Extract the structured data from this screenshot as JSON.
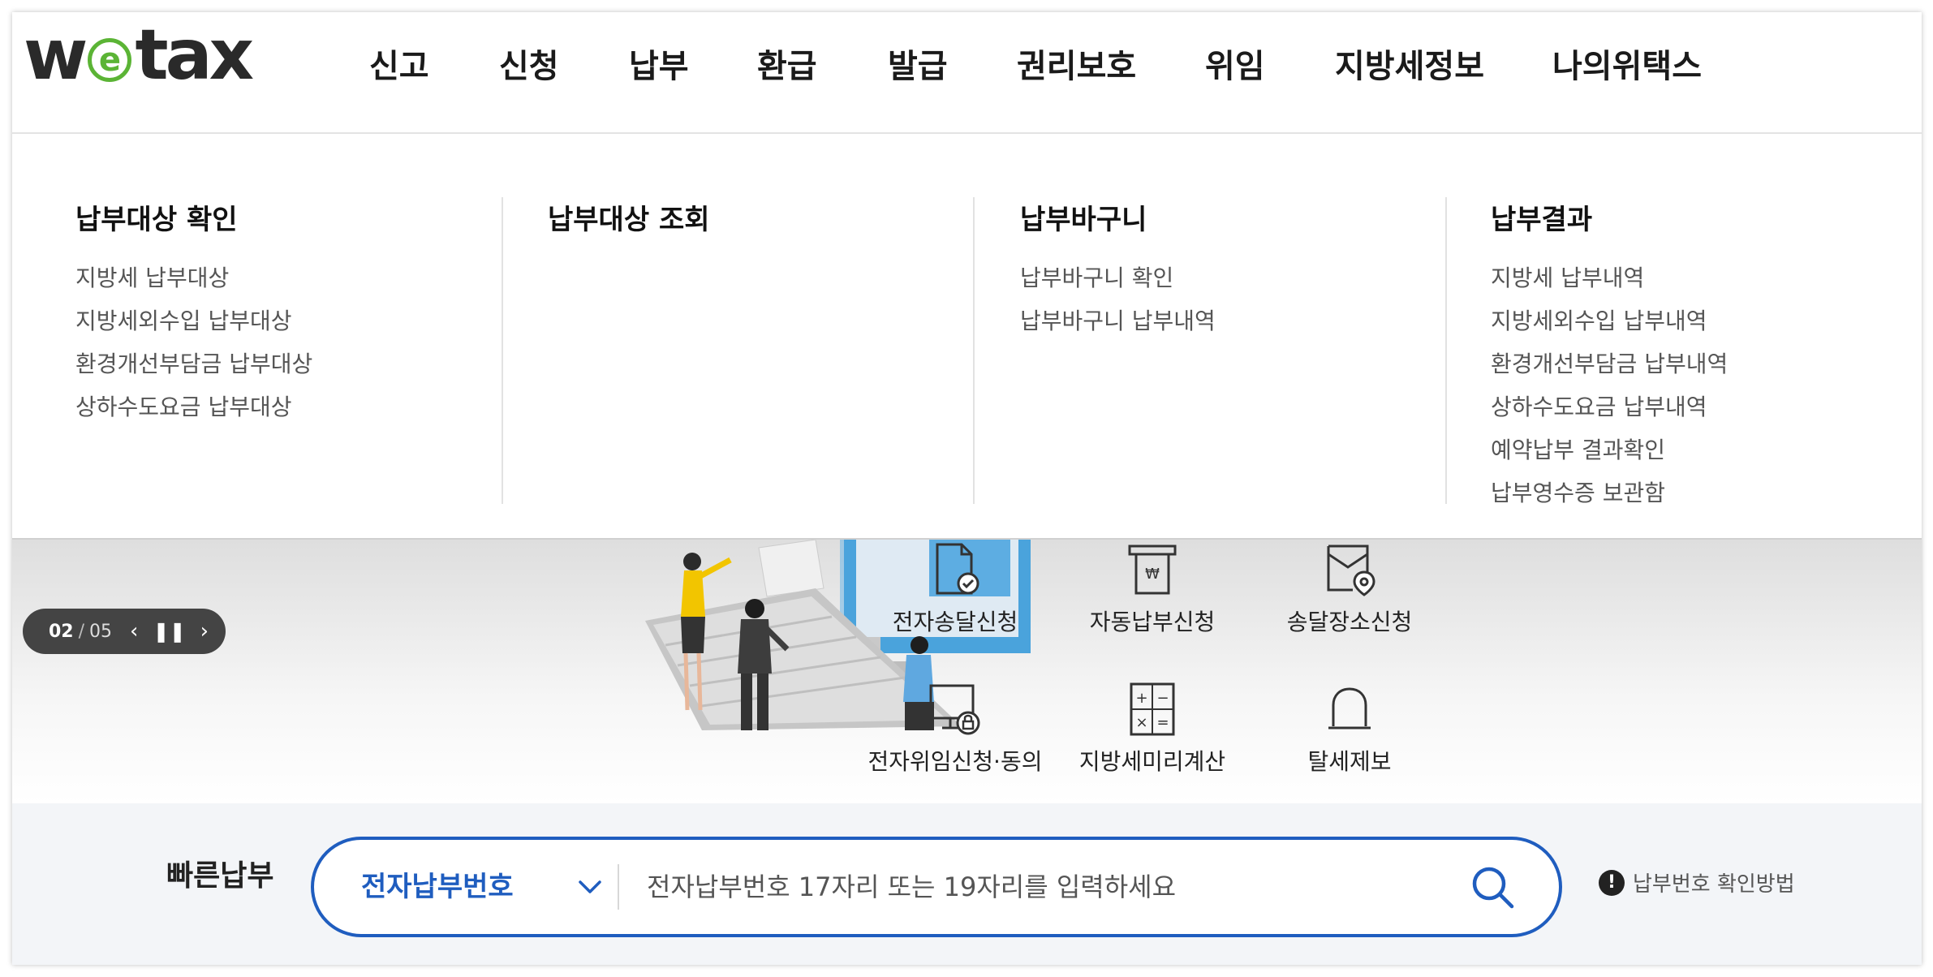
{
  "logo": {
    "pre": "w",
    "e": "e",
    "post": "tax"
  },
  "gnb": [
    "신고",
    "신청",
    "납부",
    "환급",
    "발급",
    "권리보호",
    "위임",
    "지방세정보",
    "나의위택스"
  ],
  "mega_menu": [
    {
      "title": "납부대상 확인",
      "links": [
        "지방세 납부대상",
        "지방세외수입 납부대상",
        "환경개선부담금 납부대상",
        "상하수도요금 납부대상"
      ]
    },
    {
      "title": "납부대상 조회",
      "links": []
    },
    {
      "title": "납부바구니",
      "links": [
        "납부바구니 확인",
        "납부바구니 납부내역"
      ]
    },
    {
      "title": "납부결과",
      "links": [
        "지방세 납부내역",
        "지방세외수입 납부내역",
        "환경개선부담금 납부내역",
        "상하수도요금 납부내역",
        "예약납부 결과확인",
        "납부영수증 보관함"
      ]
    }
  ],
  "slider": {
    "current": "02",
    "separator": "/",
    "total": "05"
  },
  "quick_menu": [
    {
      "label": "전자송달신청",
      "icon": "document-check-icon"
    },
    {
      "label": "자동납부신청",
      "icon": "auto-payment-icon"
    },
    {
      "label": "송달장소신청",
      "icon": "location-envelope-icon"
    },
    {
      "label": "전자위임신청·동의",
      "icon": "monitor-lock-icon"
    },
    {
      "label": "지방세미리계산",
      "icon": "calculator-icon"
    },
    {
      "label": "탈세제보",
      "icon": "alarm-bell-icon"
    }
  ],
  "quick_pay": {
    "label": "빠른납부",
    "select_value": "전자납부번호",
    "placeholder": "전자납부번호 17자리 또는 19자리를 입력하세요",
    "help_text": "납부번호 확인방법",
    "help_icon": "!"
  },
  "colors": {
    "accent": "#1f5dbf",
    "logo_green": "#5bb435",
    "dark": "#444444"
  }
}
